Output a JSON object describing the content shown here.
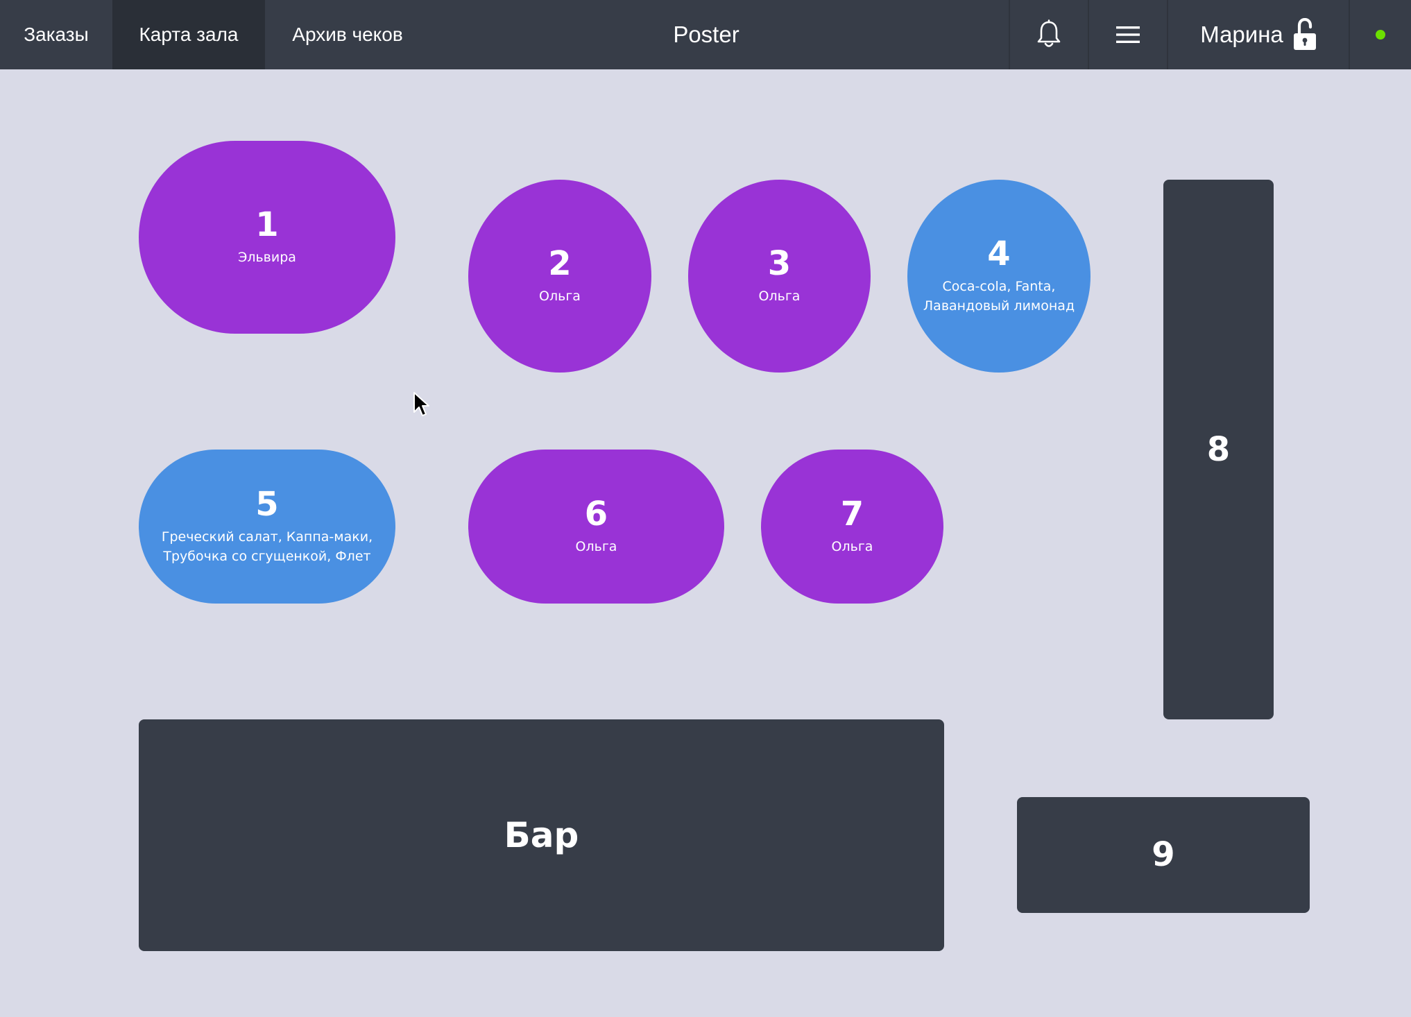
{
  "header": {
    "tabs": [
      {
        "label": "Заказы",
        "active": false
      },
      {
        "label": "Карта зала",
        "active": true
      },
      {
        "label": "Архив чеков",
        "active": false
      }
    ],
    "app_title": "Poster",
    "user_name": "Марина",
    "icons": [
      "bell-icon",
      "hamburger-menu-icon",
      "unlocked-padlock-icon"
    ],
    "online_status_color": "#6ce000"
  },
  "floor": {
    "tables": [
      {
        "number": "1",
        "subtitle": "Эльвира",
        "color": "#9933d6"
      },
      {
        "number": "2",
        "subtitle": "Ольга",
        "color": "#9933d6"
      },
      {
        "number": "3",
        "subtitle": "Ольга",
        "color": "#9933d6"
      },
      {
        "number": "4",
        "subtitle_lines": [
          "Coca-cola, Fanta,",
          "Лавандовый лимонад"
        ],
        "color": "#4a90e2"
      },
      {
        "number": "5",
        "subtitle_lines": [
          "Греческий салат, Каппа-маки,",
          "Трубочка со сгущенкой, Флет"
        ],
        "color": "#4a90e2"
      },
      {
        "number": "6",
        "subtitle": "Ольга",
        "color": "#9933d6"
      },
      {
        "number": "7",
        "subtitle": "Ольга",
        "color": "#9933d6"
      },
      {
        "number": "8",
        "color": "#373d48"
      },
      {
        "number": "Бар",
        "color": "#373d48"
      },
      {
        "number": "9",
        "color": "#373d48"
      }
    ]
  },
  "colors": {
    "background": "#d9dae7",
    "topbar": "#373d48",
    "occupied_waiter": "#9933d6",
    "occupied_order": "#4a90e2",
    "free_table": "#373d48"
  }
}
